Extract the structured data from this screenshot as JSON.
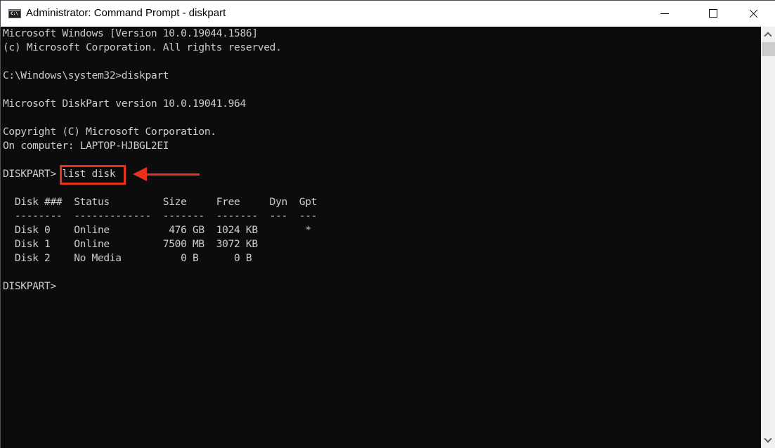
{
  "window": {
    "title": "Administrator: Command Prompt - diskpart",
    "app_icon": "command-prompt-icon",
    "controls": {
      "minimize": "minimize-icon",
      "maximize": "maximize-icon",
      "close": "close-icon"
    }
  },
  "console": {
    "lines": [
      "Microsoft Windows [Version 10.0.19044.1586]",
      "(c) Microsoft Corporation. All rights reserved.",
      "",
      "C:\\Windows\\system32>diskpart",
      "",
      "Microsoft DiskPart version 10.0.19041.964",
      "",
      "Copyright (C) Microsoft Corporation.",
      "On computer: LAPTOP-HJBGL2EI",
      "",
      "DISKPART> list disk",
      "",
      "  Disk ###  Status         Size     Free     Dyn  Gpt",
      "  --------  -------------  -------  -------  ---  ---",
      "  Disk 0    Online          476 GB  1024 KB        *",
      "  Disk 1    Online         7500 MB  3072 KB",
      "  Disk 2    No Media          0 B      0 B",
      "",
      "DISKPART>"
    ],
    "highlighted_command": "list disk",
    "disk_table": {
      "columns": [
        "Disk ###",
        "Status",
        "Size",
        "Free",
        "Dyn",
        "Gpt"
      ],
      "rows": [
        [
          "Disk 0",
          "Online",
          "476 GB",
          "1024 KB",
          "",
          "*"
        ],
        [
          "Disk 1",
          "Online",
          "7500 MB",
          "3072 KB",
          "",
          ""
        ],
        [
          "Disk 2",
          "No Media",
          "0 B",
          "0 B",
          "",
          ""
        ]
      ]
    }
  },
  "annotation": {
    "color": "#e8301c",
    "arrow_direction": "left"
  }
}
